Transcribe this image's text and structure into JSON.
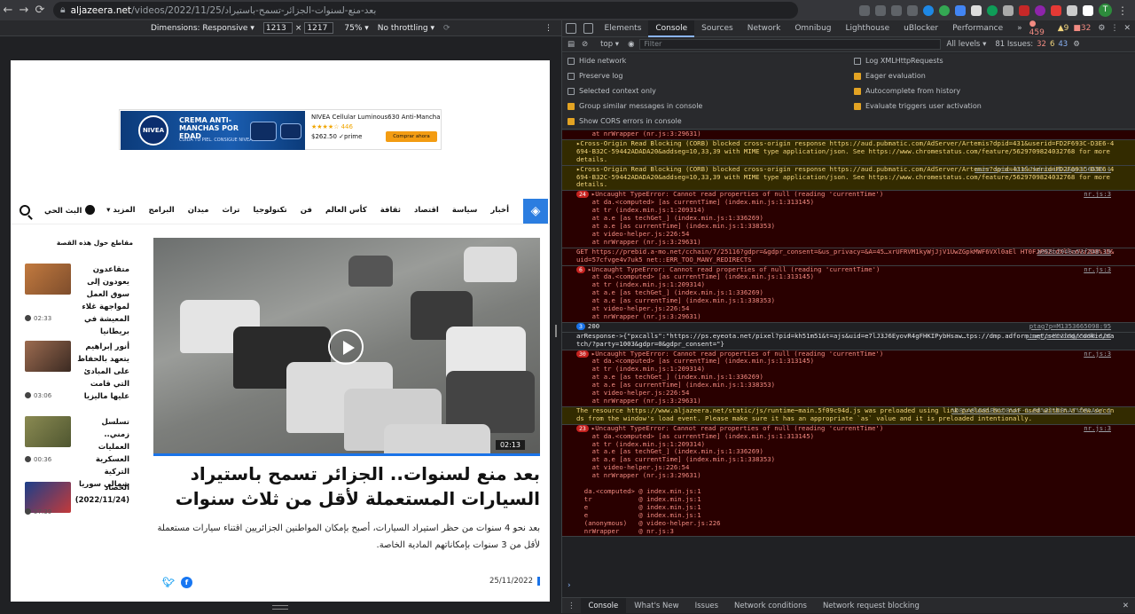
{
  "browser": {
    "back": "←",
    "forward": "→",
    "reload": "⟳",
    "url_domain": "aljazeera.net",
    "url_path": "/videos/2022/11/25/بعد-منع-لسنوات-الجزائر-تسمح-باستيراد",
    "avatar_letter": "T"
  },
  "device_toolbar": {
    "dimensions": "Dimensions: Responsive ▾",
    "width": "1213",
    "times": "×",
    "height": "1217",
    "zoom": "75% ▾",
    "throttle": "No throttling ▾"
  },
  "ad": {
    "brand": "NIVEA",
    "headline": "CREMA ANTI-MANCHAS POR EDAD",
    "subline": "CUIDA TU PIEL. CONSIGUE NIVEA",
    "product_title": "NIVEA Cellular Luminous630 Anti-Mancha...",
    "stars": "★★★★☆ 446",
    "price": "$262.50 ✓prime",
    "buy_label": "Comprar ahora"
  },
  "site_nav": {
    "items": [
      "أخبار",
      "سياسة",
      "اقتصاد",
      "ثقافة",
      "كأس العالم",
      "فن",
      "تكنولوجيا",
      "تراث",
      "ميدان",
      "البرامج",
      "المزيد ▾"
    ],
    "live": "البث الحي"
  },
  "video": {
    "duration": "02:13"
  },
  "article": {
    "headline": "بعد منع لسنوات.. الجزائر تسمح باستيراد السيارات المستعملة لأقل من ثلاث سنوات",
    "summary": "بعد نحو 4 سنوات من حظر استيراد السيارات، أصبح بإمكان المواطنين الجزائريين اقتناء سيارات مستعملة لأقل من 3 سنوات بإمكاناتهم المادية الخاصة.",
    "date": "25/11/2022"
  },
  "sidebar": {
    "title": "مقاطع حول هذه القصة",
    "items": [
      {
        "text": "متقاعدون يعودون إلى سوق العمل لمواجهة غلاء المعيشة في بريطانيا",
        "time": "02:33"
      },
      {
        "text": "أنور إبراهيم يتعهد بالحفاظ على المبادئ التي قامت عليها ماليزيا",
        "time": "03:06"
      },
      {
        "text": "تسلسل زمني.. العمليات العسكرية التركية شمالي سوريا",
        "time": "00:36"
      },
      {
        "text": "الحصاد (2022/11/24)",
        "time": "57:39"
      }
    ]
  },
  "devtools": {
    "tabs": [
      "Elements",
      "Console",
      "Sources",
      "Network",
      "Omnibug",
      "Lighthouse",
      "uBlocker",
      "Performance",
      "»"
    ],
    "active_tab": "Console",
    "counts": {
      "errors": "459",
      "warnings": "9",
      "other": "32"
    },
    "context": "top ▾",
    "filter_placeholder": "Filter",
    "levels": "All levels ▾",
    "issues": "81 Issues:",
    "issue_counts": [
      "32",
      "6",
      "43"
    ],
    "settings_left": [
      "Hide network",
      "Preserve log",
      "Selected context only",
      "Group similar messages in console",
      "Show CORS errors in console"
    ],
    "settings_right": [
      "Log XMLHttpRequests",
      "Eager evaluation",
      "Autocomplete from history",
      "Evaluate triggers user activation"
    ],
    "console_entries": [
      {
        "type": "err",
        "count": "",
        "text": "    at nrWrapper (nr.js:3:29631)",
        "src": ""
      },
      {
        "type": "warn",
        "count": "",
        "text": "▸Cross-Origin Read Blocking (CORB) blocked cross-origin response https://aud.pubmatic.com/AdServer/Artemis?dpid=431&userid=FD2F693C-D3E6-4694-B32C-59442ADADA20&addseg=10,33,39 with MIME type application/json. See https://www.chromestatus.com/feature/5629709824032768 for more details.",
        "src": ""
      },
      {
        "type": "warn",
        "count": "",
        "text": "▸Cross-Origin Read Blocking (CORB) blocked cross-origin response https://aud.pubmatic.com/AdServer/Artemis?dpid=431&userid=FD2F693C-D3E6-4694-B32C-59442ADADA20&addseg=10,33,39 with MIME type application/json. See https://www.chromestatus.com/feature/5629709824032768 for more details.",
        "src": "user sync.html?kdntuid=1&p=156696:1"
      },
      {
        "type": "err",
        "count": "24",
        "text": "▸Uncaught TypeError: Cannot read properties of null (reading 'currentTime')\n    at da.<computed> [as currentTime] (index.min.js:1:313145)\n    at tr (index.min.js:1:209314)\n    at a.e [as techGet_] (index.min.js:1:336269)\n    at a.e [as currentTime] (index.min.js:1:338353)\n    at video-helper.js:226:54\n    at nrWrapper (nr.js:3:29631)",
        "src": "nr.js:3"
      },
      {
        "type": "err",
        "count": "",
        "text": "GET https://prebid.a-mo.net/cchain/7/25116?gdpr=&gdpr_consent=&us_privacy=&A=45…xrUFRVM1kyWjJjV1UwZGpkMWF6VXl0aEl HT0FJPSZidXllcnVzZD0%3D&uid=57cfvge4v7uk5 net::ERR_TOO_MANY_REDIRECTS",
        "src": "a068b2948a53f248:19"
      },
      {
        "type": "err",
        "count": "6",
        "text": "▸Uncaught TypeError: Cannot read properties of null (reading 'currentTime')\n    at da.<computed> [as currentTime] (index.min.js:1:313145)\n    at tr (index.min.js:1:209314)\n    at a.e [as techGet_] (index.min.js:1:336269)\n    at a.e [as currentTime] (index.min.js:1:338353)\n    at video-helper.js:226:54\n    at nrWrapper (nr.js:3:29631)",
        "src": "nr.js:3"
      },
      {
        "type": "info",
        "count": "3",
        "text": "200",
        "src": "ptag?p=M1353665098:95"
      },
      {
        "type": "info",
        "count": "",
        "text": "arResponse->{\"pxcalls\":\"https://ps.eyeota.net/pixel?pid=kh51m51&t=ajs&uid=e7lJ3J6EyovR4gFHKIPybHsaw…tps://dmp.adform.net/serving/cookie/match/?party=1003&gdpr=0&gdpr_consent=\"}",
        "src": "ptag?p=M1353665098:127"
      },
      {
        "type": "err",
        "count": "30",
        "text": "▸Uncaught TypeError: Cannot read properties of null (reading 'currentTime')\n    at da.<computed> [as currentTime] (index.min.js:1:313145)\n    at tr (index.min.js:1:209314)\n    at a.e [as techGet_] (index.min.js:1:336269)\n    at a.e [as currentTime] (index.min.js:1:338353)\n    at video-helper.js:226:54\n    at nrWrapper (nr.js:3:29631)",
        "src": "nr.js:3"
      },
      {
        "type": "warn",
        "count": "",
        "text": "The resource https://www.aljazeera.net/static/js/runtime~main.5f09c94d.js was preloaded using link preload but not used within a few seconds from the window's load event. Please make sure it has an appropriate `as` value and it is preloaded intentionally.",
        "src": "%D8%A8%D8%B9%D8%AF-%…D8%B1%D8%A7%D8%AA/:1"
      },
      {
        "type": "err",
        "count": "23",
        "text": "▸Uncaught TypeError: Cannot read properties of null (reading 'currentTime')\n    at da.<computed> [as currentTime] (index.min.js:1:313145)\n    at tr (index.min.js:1:209314)\n    at a.e [as techGet_] (index.min.js:1:336269)\n    at a.e [as currentTime] (index.min.js:1:338353)\n    at video-helper.js:226:54\n    at nrWrapper (nr.js:3:29631)\n\n  da.<computed> @ index.min.js:1\n  tr            @ index.min.js:1\n  e             @ index.min.js:1\n  e             @ index.min.js:1\n  (anonymous)   @ video-helper.js:226\n  nrWrapper     @ nr.js:3",
        "src": "nr.js:3"
      }
    ],
    "prompt": "›",
    "drawer_tabs": [
      "Console",
      "What's New",
      "Issues",
      "Network conditions",
      "Network request blocking"
    ],
    "drawer_close": "✕"
  },
  "colors": {
    "accent": "#1a73e8",
    "error_bg": "#290000",
    "warn_bg": "#332b00"
  }
}
